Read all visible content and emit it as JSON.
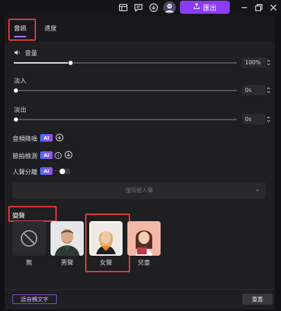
{
  "topbar": {
    "export_label": "匯出",
    "icons": [
      "layout-icon",
      "comment-icon",
      "download-icon",
      "avatar",
      "minimize-icon",
      "restore-icon",
      "close-icon"
    ]
  },
  "tabs": [
    {
      "label": "音訊",
      "active": true
    },
    {
      "label": "速度",
      "active": false
    }
  ],
  "volume": {
    "label": "音量",
    "value_text": "100%",
    "level": 1.0
  },
  "fade_in": {
    "label": "淡入",
    "value_text": "0s",
    "level": 0.0
  },
  "fade_out": {
    "label": "淡出",
    "value_text": "0s",
    "level": 0.0
  },
  "denoise": {
    "label": "音頻降噪",
    "ai": "AI"
  },
  "beat": {
    "label": "節拍檢測",
    "ai": "AI",
    "info": "i"
  },
  "vocal": {
    "label": "人聲分離",
    "ai": "AI",
    "dash": "-",
    "enabled": false
  },
  "vocal_select": {
    "placeholder": "僅保留人聲"
  },
  "voice_change": {
    "title": "變聲",
    "options": [
      {
        "label": "無",
        "selected": false
      },
      {
        "label": "男聲",
        "selected": false
      },
      {
        "label": "女聲",
        "selected": true
      },
      {
        "label": "兒童",
        "selected": false
      }
    ]
  },
  "footer": {
    "speech_to_text": "語音轉文字",
    "reset": "重置"
  },
  "colors": {
    "accent": "#8a3cf5",
    "highlight": "#e23b3b",
    "background": "#1f1f22"
  }
}
